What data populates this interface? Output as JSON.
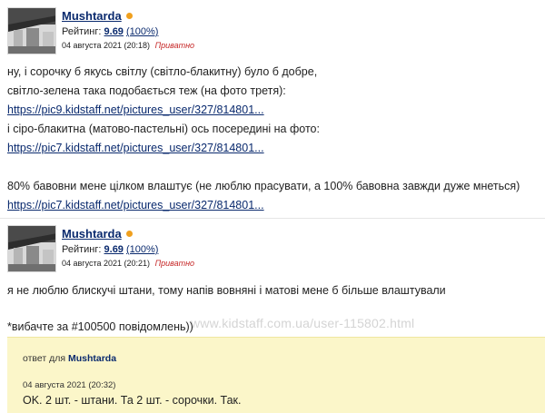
{
  "colors": {
    "link": "#0a2a6e",
    "private": "#c62828",
    "online": "#f0a01e",
    "reply_bg": "#fbf6c9"
  },
  "post1": {
    "author": "Mushtarda",
    "rating_label": "Рейтинг:",
    "rating_value": "9.69",
    "rating_percent": "(100%)",
    "date": "04 августа 2021 (20:18)",
    "private": "Приватно",
    "lines": [
      "ну, і сорочку б якусь світлу (світло-блакитну) було б добре,",
      "світло-зелена така подобається теж (на фото третя):",
      "https://pic9.kidstaff.net/pictures_user/327/814801...",
      "і сіро-блакитна (матово-пастельні) ось посередині на фото:",
      "https://pic7.kidstaff.net/pictures_user/327/814801...",
      "80% бавовни мене цілком влаштує (не люблю прасувати, а 100% бавовна завжди дуже мнеться)",
      "https://pic7.kidstaff.net/pictures_user/327/814801..."
    ]
  },
  "post2": {
    "author": "Mushtarda",
    "rating_label": "Рейтинг:",
    "rating_value": "9.69",
    "rating_percent": "(100%)",
    "date": "04 августа 2021 (20:21)",
    "private": "Приватно",
    "lines": [
      "я не люблю блискучі штани, тому напів вовняні і матові мене б більше влаштували",
      "*вибачте за #100500 повідомлень))"
    ]
  },
  "reply": {
    "prefix": "ответ для",
    "to": "Mushtarda",
    "date": "04 августа 2021 (20:32)",
    "text": "OK. 2 шт. - штани. Та 2 шт. - сорочки. Так."
  },
  "watermark": "www.kidstaff.com.ua/user-115802.html"
}
